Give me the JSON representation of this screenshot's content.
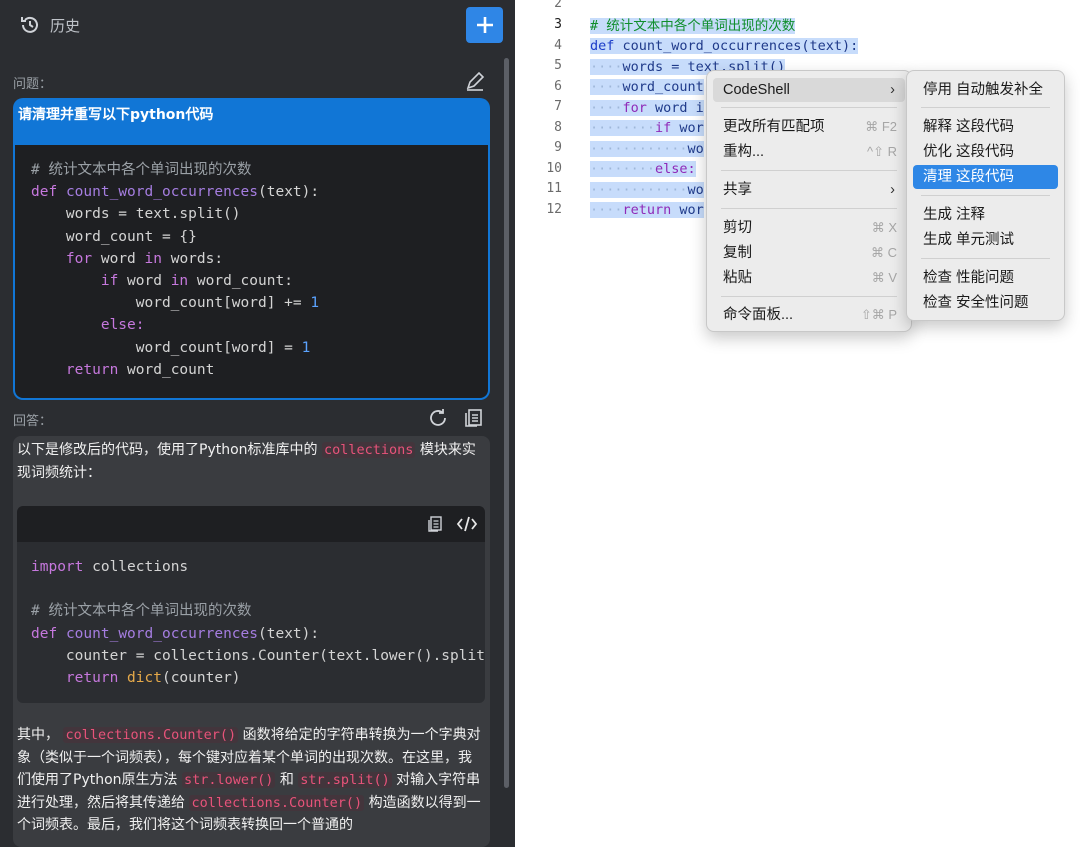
{
  "sidebar": {
    "title": "历史",
    "question_label": "问题：",
    "question_title": "请清理并重写以下python代码",
    "answer_label": "回答：",
    "answer_intro_1": "以下是修改后的代码，使用了Python标准库中的",
    "answer_intro_code": "collections",
    "answer_intro_2": "模块来实现词频统计：",
    "answer_para": {
      "p1": "其中，",
      "c1": "collections.Counter()",
      "p2": "函数将给定的字符串转换为一个字典对象（类似于一个词频表），每个键对应着某个单词的出现次数。在这里，我们使用了Python原生方法",
      "c2": "str.lower()",
      "p3": "和",
      "c3": "str.split()",
      "p4": "对输入字符串进行处理，然后将其传递给",
      "c4": "collections.Counter()",
      "p5": "构造函数以得到一个词频表。最后，我们将这个词频表转换回一个普通的"
    }
  },
  "question_code": {
    "comment": "# 统计文本中各个单词出现的次数",
    "def_kw": "def",
    "fn_name": "count_word_occurrences",
    "params": "(text):",
    "l2": "    words = text.split()",
    "l3": "    word_count = {}",
    "for_kw": "for",
    "for_rest": " word ",
    "in_kw": "in",
    "for_tail": " words:",
    "if_kw": "if",
    "if_rest": " word ",
    "if_tail": " word_count:",
    "inc": "word_count[word] += ",
    "one": "1",
    "else_kw": "else:",
    "assign": "word_count[word] = ",
    "return_kw": "return",
    "return_rest": " word_count"
  },
  "answer_code": {
    "import_kw": "import",
    "import_rest": " collections",
    "comment": "# 统计文本中各个单词出现的次数",
    "def_kw": "def",
    "fn_name": "count_word_occurrences",
    "params": "(text):",
    "l_counter": "    counter = collections.Counter(text.lower().split",
    "return_kw": "return",
    "dict_fn": "dict",
    "dict_arg": "(counter)"
  },
  "editor": {
    "line_numbers": [
      "2",
      "3",
      "4",
      "5",
      "6",
      "7",
      "8",
      "9",
      "10",
      "11",
      "12"
    ],
    "lines": {
      "l3": "# 统计文本中各个单词出现的次数",
      "l4_kw": "def",
      "l4_rest": " count_word_occurrences(text):",
      "l5": "words = text.split()",
      "l6": "word_count",
      "l7_kw": "for",
      "l7_rest": " word i",
      "l8_kw": "if",
      "l8_rest": " wor",
      "l9": "wo",
      "l10_kw": "else:",
      "l11": "wo",
      "l12_kw": "return",
      "l12_rest": " wor"
    }
  },
  "context_menu": {
    "items": [
      {
        "label": "CodeShell",
        "shortcut": "",
        "submenu": true
      },
      {
        "label": "更改所有匹配项",
        "shortcut": "⌘ F2"
      },
      {
        "label": "重构...",
        "shortcut": "^⇧ R"
      },
      {
        "label": "共享",
        "shortcut": "",
        "submenu": true
      },
      {
        "label": "剪切",
        "shortcut": "⌘ X"
      },
      {
        "label": "复制",
        "shortcut": "⌘ C"
      },
      {
        "label": "粘贴",
        "shortcut": "⌘ V"
      },
      {
        "label": "命令面板...",
        "shortcut": "⇧⌘ P"
      }
    ],
    "arrow": "›"
  },
  "submenu": {
    "items": [
      "停用 自动触发补全",
      "解释 这段代码",
      "优化 这段代码",
      "清理 这段代码",
      "生成 注释",
      "生成 单元测试",
      "检查 性能问题",
      "检查 安全性问题"
    ]
  },
  "colors": {
    "accent": "#2f86e6",
    "question_bg": "#1176d6",
    "selection": "#c7dcfb"
  }
}
